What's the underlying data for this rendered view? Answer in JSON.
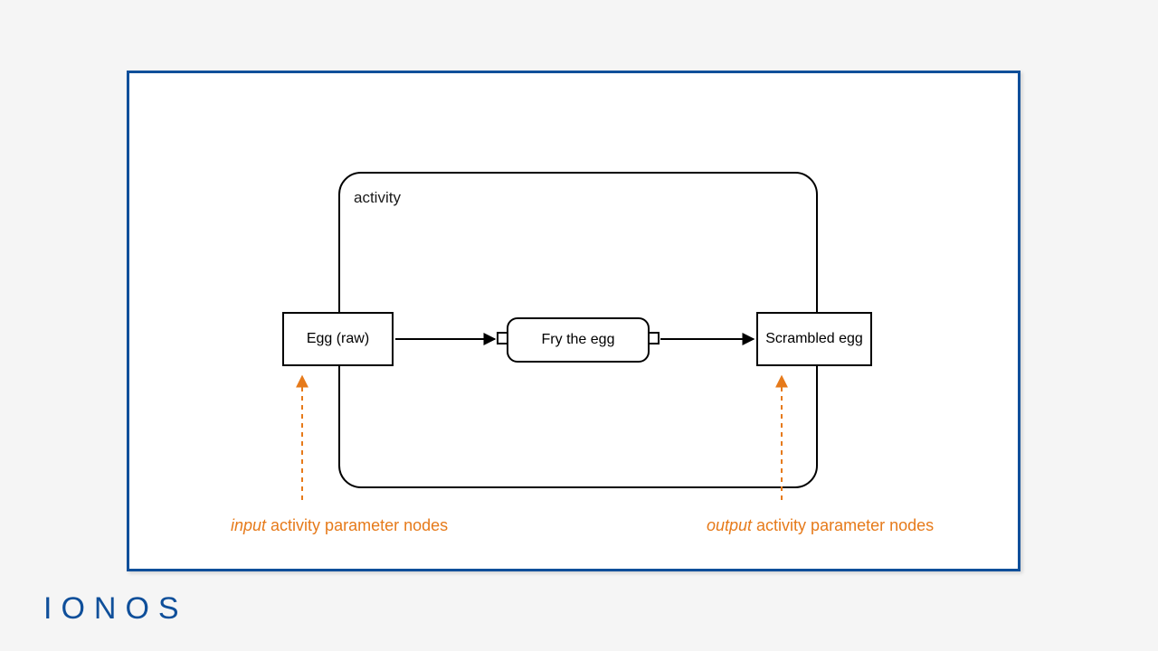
{
  "diagram": {
    "activity_label": "activity",
    "input_node": "Egg (raw)",
    "action_node": "Fry the egg",
    "output_node": "Scrambled egg",
    "annotation_input_emph": "input",
    "annotation_input_rest": " activity parameter nodes",
    "annotation_output_emph": "output",
    "annotation_output_rest": " activity parameter nodes"
  },
  "brand": {
    "logo": "IONOS"
  },
  "colors": {
    "frame_border": "#0f4f9a",
    "annotation": "#e67a1a"
  }
}
